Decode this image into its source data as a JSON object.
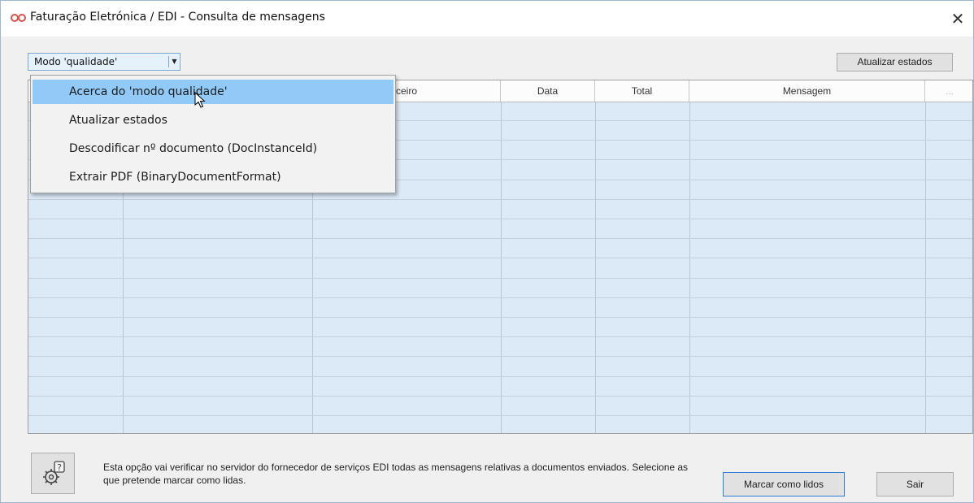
{
  "window": {
    "title": "Faturação Eletrónica / EDI - Consulta de mensagens",
    "close_label": "✕"
  },
  "toolbar": {
    "mode_button_label": "Modo 'qualidade'",
    "refresh_label": "Atualizar estados"
  },
  "menu": {
    "items": [
      {
        "label": "Acerca do 'modo qualidade'",
        "highlighted": true
      },
      {
        "label": "Atualizar estados"
      },
      {
        "label": "Descodificar nº documento (DocInstanceId)"
      },
      {
        "label": "Extrair PDF (BinaryDocumentFormat)"
      }
    ]
  },
  "grid": {
    "columns": [
      {
        "label": ""
      },
      {
        "label": ""
      },
      {
        "label": "rceiro"
      },
      {
        "label": "Data"
      },
      {
        "label": "Total"
      },
      {
        "label": "Mensagem"
      },
      {
        "label": "..."
      }
    ],
    "rows": []
  },
  "footer": {
    "info_text": "Esta opção vai verificar no servidor do fornecedor de serviços EDI todas as mensagens relativas a documentos enviados. Selecione as que pretende marcar como lidas.",
    "mark_read_label": "Marcar como lidos",
    "exit_label": "Sair"
  },
  "icons": {
    "app": "infinity-icon",
    "help": "gear-help-icon",
    "cursor": "mouse-pointer-icon"
  },
  "colors": {
    "accent": "#91c9f7",
    "grid_background": "#dce9f7",
    "app_icon": "#d9534f"
  }
}
